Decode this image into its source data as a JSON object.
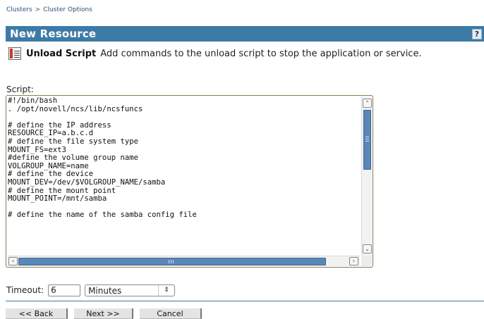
{
  "breadcrumb": {
    "items": [
      "Clusters",
      "Cluster Options"
    ],
    "separator": ">"
  },
  "header": {
    "title": "New Resource",
    "help_label": "?"
  },
  "step": {
    "icon": "script-document-icon",
    "title": "Unload Script",
    "description": "Add commands to the unload script to stop the application or service."
  },
  "script": {
    "label": "Script:",
    "content": "#!/bin/bash\n. /opt/novell/ncs/lib/ncsfuncs\n\n# define the IP address\nRESOURCE_IP=a.b.c.d\n# define the file system type\nMOUNT_FS=ext3\n#define the volume group name\nVOLGROUP_NAME=name\n# define the device\nMOUNT_DEV=/dev/$VOLGROUP_NAME/samba\n# define the mount point\nMOUNT_POINT=/mnt/samba\n\n# define the name of the samba config file"
  },
  "timeout": {
    "label": "Timeout:",
    "value": "6",
    "unit_selected": "Minutes"
  },
  "buttons": {
    "back": "<< Back",
    "next": "Next >>",
    "cancel": "Cancel"
  },
  "colors": {
    "header_bg": "#3d7ba6",
    "header_text": "#ffffff",
    "breadcrumb_link": "#2a4f7a",
    "scrollbar_thumb": "#5b86b8"
  }
}
